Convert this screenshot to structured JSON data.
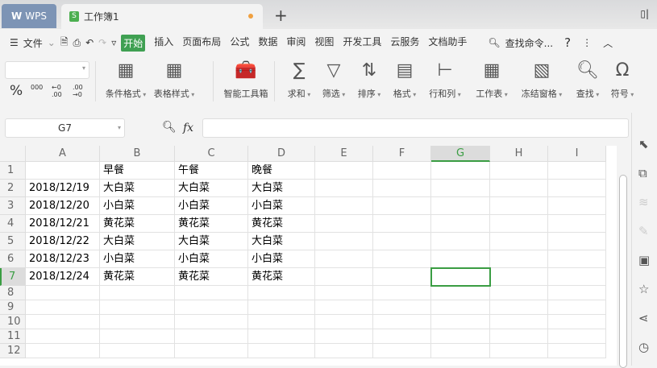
{
  "tabs": {
    "wps": "WPS",
    "doc": "工作簿1"
  },
  "menu": {
    "file": "文件",
    "items": [
      "开始",
      "插入",
      "页面布局",
      "公式",
      "数据",
      "审阅",
      "视图",
      "开发工具",
      "云服务",
      "文档助手"
    ],
    "active": 0,
    "search": "查找命令...",
    "help": "?"
  },
  "ribbon": {
    "percent": "%",
    "thousands": "000",
    "inc_dec": "←0 .00",
    "dec_dec": ".00 →0",
    "buttons": [
      "条件格式",
      "表格样式",
      "智能工具箱",
      "求和",
      "筛选",
      "排序",
      "格式",
      "行和列",
      "工作表",
      "冻结窗格",
      "查找",
      "符号"
    ]
  },
  "formula": {
    "name_box": "G7",
    "fx": "fx",
    "value": ""
  },
  "sheet": {
    "columns": [
      "A",
      "B",
      "C",
      "D",
      "E",
      "F",
      "G",
      "H",
      "I"
    ],
    "row_numbers": [
      "1",
      "2",
      "3",
      "4",
      "5",
      "6",
      "7",
      "8",
      "9",
      "10",
      "11",
      "12"
    ],
    "rows": [
      [
        "",
        "早餐",
        "午餐",
        "晚餐"
      ],
      [
        "2018/12/19",
        "大白菜",
        "大白菜",
        "大白菜"
      ],
      [
        "2018/12/20",
        "小白菜",
        "小白菜",
        "小白菜"
      ],
      [
        "2018/12/21",
        "黄花菜",
        "黄花菜",
        "黄花菜"
      ],
      [
        "2018/12/22",
        "大白菜",
        "大白菜",
        "大白菜"
      ],
      [
        "2018/12/23",
        "小白菜",
        "小白菜",
        "小白菜"
      ],
      [
        "2018/12/24",
        "黄花菜",
        "黄花菜",
        "黄花菜"
      ]
    ],
    "selected": "G7"
  },
  "colors": {
    "accent": "#3fa052"
  }
}
